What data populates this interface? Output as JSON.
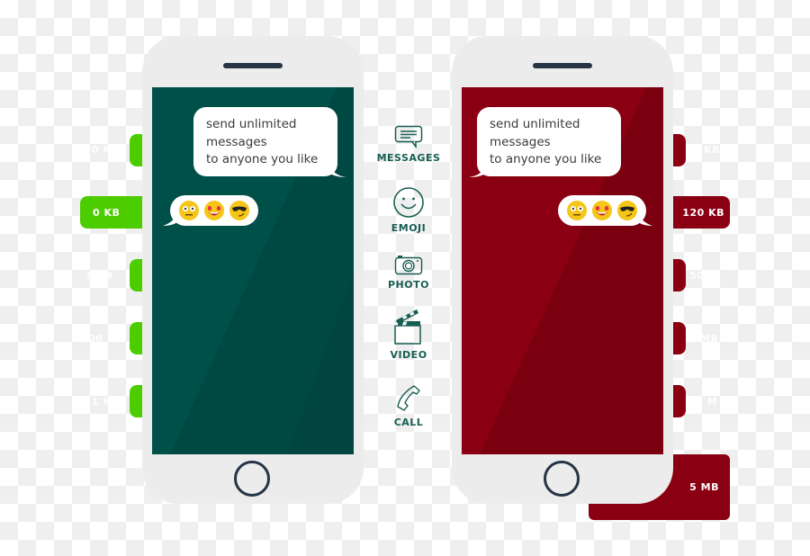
{
  "colors": {
    "green_accent": "#4ccd00",
    "red_accent": "#8a0012",
    "green_screen": "#00504a",
    "red_screen": "#8a0012",
    "phone_body": "#ececec",
    "feature_text": "#175e52"
  },
  "left_tabs": [
    {
      "label": "0 K",
      "state": "ghost"
    },
    {
      "label": "0 KB",
      "state": "active"
    },
    {
      "label": "1   KB",
      "state": "ghost"
    },
    {
      "label": "00",
      "state": "ghost"
    },
    {
      "label": "1 M",
      "state": "ghost"
    }
  ],
  "right_tabs": [
    {
      "label": "KB",
      "state": "ghost"
    },
    {
      "label": "120 KB",
      "state": "active"
    },
    {
      "label": "50",
      "state": "ghost"
    },
    {
      "label": "MB",
      "state": "ghost"
    },
    {
      "label": "M",
      "state": "ghost"
    },
    {
      "label": "5 MB",
      "state": "active"
    }
  ],
  "left_phone": {
    "message_lines": [
      "send unlimited",
      "messages",
      "to anyone you like"
    ],
    "emojis": [
      "neutral-face",
      "heart-eyes-face",
      "cool-sunglasses-face"
    ]
  },
  "right_phone": {
    "message_lines": [
      "send unlimited",
      "messages",
      "to anyone you like"
    ],
    "emojis": [
      "neutral-face",
      "heart-eyes-face",
      "cool-sunglasses-face"
    ]
  },
  "features": [
    {
      "label": "MESSAGES",
      "icon": "message-icon"
    },
    {
      "label": "EMOJI",
      "icon": "smiley-icon"
    },
    {
      "label": "PHOTO",
      "icon": "camera-icon"
    },
    {
      "label": "VIDEO",
      "icon": "clapperboard-icon"
    },
    {
      "label": "CALL",
      "icon": "phone-icon"
    }
  ]
}
